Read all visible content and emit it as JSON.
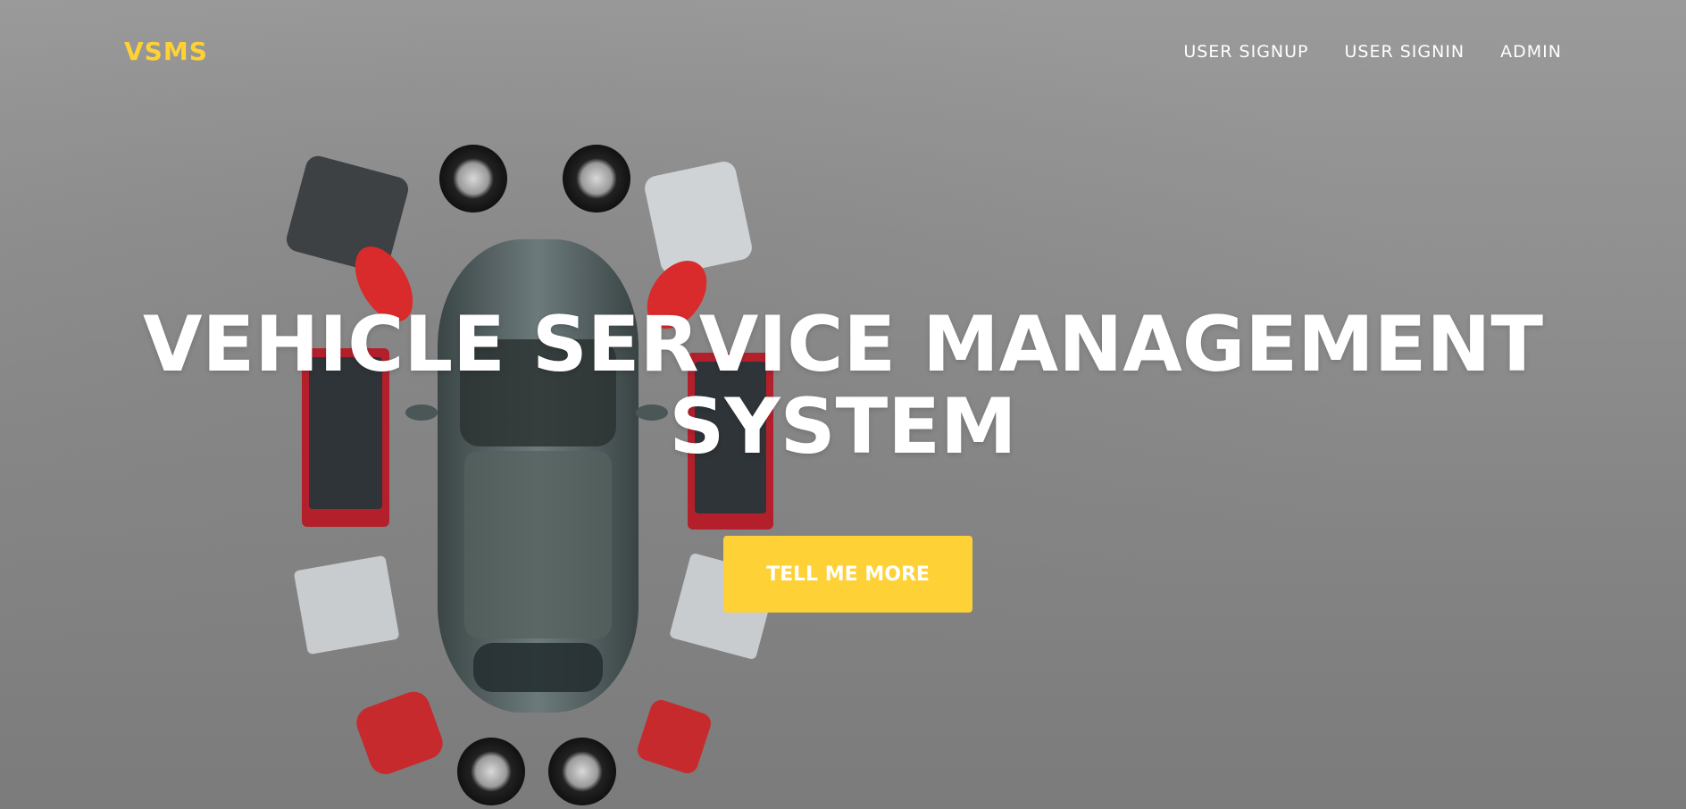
{
  "brand": {
    "name": "VSMS",
    "color": "#fed136"
  },
  "nav": {
    "items": [
      {
        "label": "USER SIGNUP"
      },
      {
        "label": "USER SIGNIN"
      },
      {
        "label": "ADMIN"
      }
    ]
  },
  "hero": {
    "title_line1": "VEHICLE SERVICE MANAGEMENT",
    "title_line2": "SYSTEM",
    "cta_label": "TELL ME MORE",
    "cta_color": "#fed136",
    "background": "garage-top-view-car-photo"
  }
}
